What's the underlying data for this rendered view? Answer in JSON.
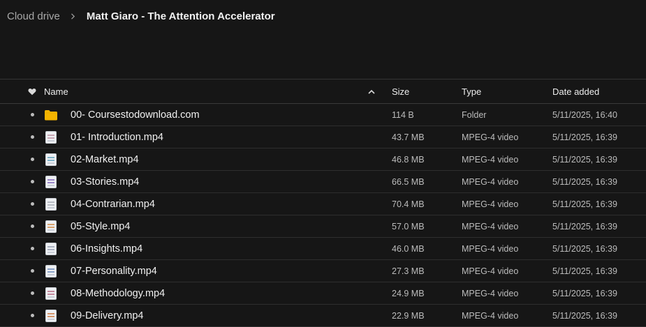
{
  "breadcrumb": {
    "root": "Cloud drive",
    "current": "Matt Giaro - The Attention Accelerator"
  },
  "columns": {
    "name": "Name",
    "size": "Size",
    "type": "Type",
    "date": "Date added"
  },
  "sort": {
    "column": "name",
    "direction": "ascending"
  },
  "files": [
    {
      "name": "00- Coursestodownload.com",
      "size": "114 B",
      "type": "Folder",
      "date": "5/11/2025, 16:40",
      "icon": "folder-icon",
      "color": "#f4b400"
    },
    {
      "name": "01- Introduction.mp4",
      "size": "43.7 MB",
      "type": "MPEG-4 video",
      "date": "5/11/2025, 16:39",
      "icon": "video-thumbnail-icon",
      "color": "#c9a7b5"
    },
    {
      "name": "02-Market.mp4",
      "size": "46.8 MB",
      "type": "MPEG-4 video",
      "date": "5/11/2025, 16:39",
      "icon": "video-thumbnail-icon",
      "color": "#7fb3c9"
    },
    {
      "name": "03-Stories.mp4",
      "size": "66.5 MB",
      "type": "MPEG-4 video",
      "date": "5/11/2025, 16:39",
      "icon": "video-thumbnail-icon",
      "color": "#9a86c9"
    },
    {
      "name": "04-Contrarian.mp4",
      "size": "70.4 MB",
      "type": "MPEG-4 video",
      "date": "5/11/2025, 16:39",
      "icon": "video-thumbnail-icon",
      "color": "#b8bcc4"
    },
    {
      "name": "05-Style.mp4",
      "size": "57.0 MB",
      "type": "MPEG-4 video",
      "date": "5/11/2025, 16:39",
      "icon": "video-thumbnail-icon",
      "color": "#d9a36f"
    },
    {
      "name": "06-Insights.mp4",
      "size": "46.0 MB",
      "type": "MPEG-4 video",
      "date": "5/11/2025, 16:39",
      "icon": "video-thumbnail-icon",
      "color": "#aab2c2"
    },
    {
      "name": "07-Personality.mp4",
      "size": "27.3 MB",
      "type": "MPEG-4 video",
      "date": "5/11/2025, 16:39",
      "icon": "video-thumbnail-icon",
      "color": "#8aa2c8"
    },
    {
      "name": "08-Methodology.mp4",
      "size": "24.9 MB",
      "type": "MPEG-4 video",
      "date": "5/11/2025, 16:39",
      "icon": "video-thumbnail-icon",
      "color": "#c48a9e"
    },
    {
      "name": "09-Delivery.mp4",
      "size": "22.9 MB",
      "type": "MPEG-4 video",
      "date": "5/11/2025, 16:39",
      "icon": "video-thumbnail-icon",
      "color": "#d4956b"
    }
  ]
}
